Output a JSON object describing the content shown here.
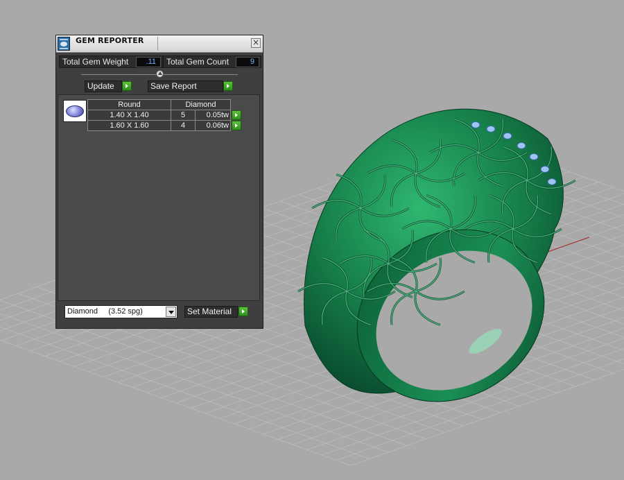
{
  "panel": {
    "title": "GEM REPORTER",
    "close_symbol": "×",
    "total_weight_label": "Total Gem Weight",
    "total_weight_value": ".11",
    "total_count_label": "Total Gem Count",
    "total_count_value": "9",
    "update_label": "Update",
    "save_report_label": "Save Report",
    "gem_shape_icon": "round-gem-icon",
    "table": {
      "headers": [
        "Round",
        "Diamond"
      ],
      "rows": [
        {
          "size": "1.40 X 1.40",
          "count": "5",
          "weight": "0.05tw"
        },
        {
          "size": "1.60 X 1.60",
          "count": "4",
          "weight": "0.06tw"
        }
      ]
    },
    "material_value": "Diamond     (3.52 spg)",
    "set_material_label": "Set Material"
  },
  "colors": {
    "viewport_bg": "#a9a9a9",
    "ring_green": "#1c8a4a",
    "accent_blue": "#6fb6ff",
    "go_green": "#3da82a"
  }
}
